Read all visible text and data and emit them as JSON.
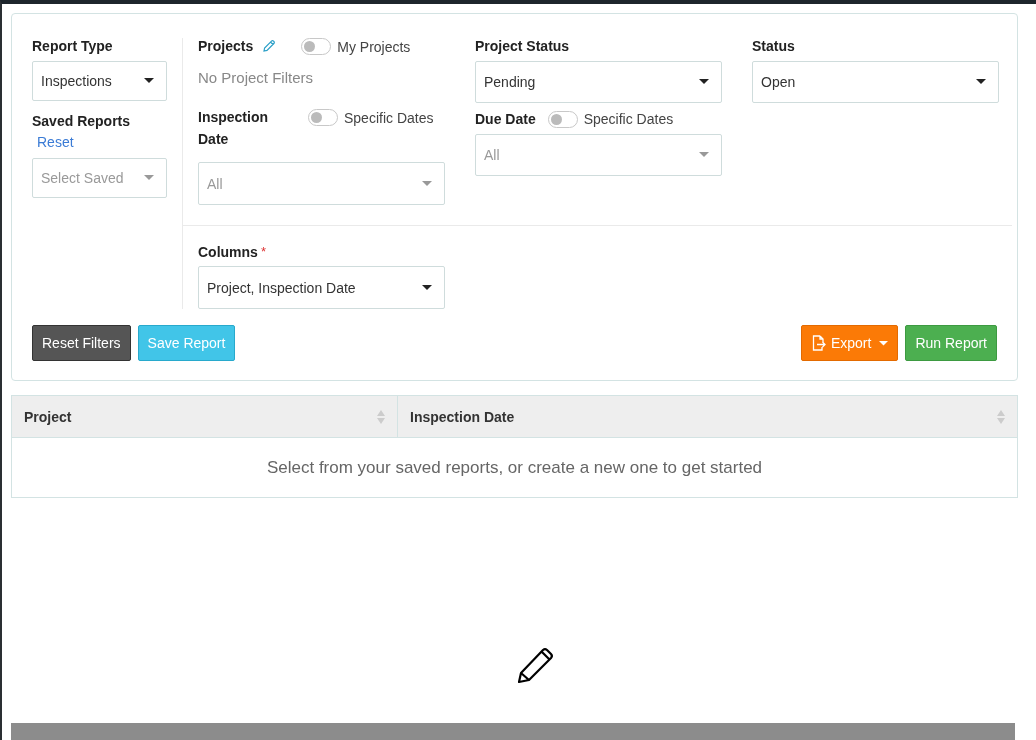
{
  "report_type": {
    "label": "Report Type",
    "select": {
      "value": "Inspections"
    }
  },
  "saved_reports": {
    "label": "Saved Reports",
    "reset_link": "Reset",
    "select": {
      "placeholder": "Select Saved"
    }
  },
  "projects": {
    "label": "Projects",
    "toggle": {
      "label": "My Projects",
      "on": false
    },
    "empty_text": "No Project Filters"
  },
  "project_status": {
    "label": "Project Status",
    "select": {
      "value": "Pending"
    }
  },
  "status": {
    "label": "Status",
    "select": {
      "value": "Open"
    }
  },
  "inspection_date": {
    "label": "Inspection Date",
    "toggle": {
      "label": "Specific Dates",
      "on": false
    },
    "select": {
      "placeholder": "All"
    }
  },
  "due_date": {
    "label": "Due Date",
    "toggle": {
      "label": "Specific Dates",
      "on": false
    },
    "select": {
      "placeholder": "All"
    }
  },
  "columns": {
    "label": "Columns",
    "required_mark": "*",
    "select": {
      "value": "Project, Inspection Date"
    }
  },
  "buttons": [
    {
      "label": "Reset Filters",
      "kind": "dark"
    },
    {
      "label": "Save Report",
      "kind": "info"
    },
    {
      "label": "Export",
      "kind": "export"
    },
    {
      "label": "Run Report",
      "kind": "success"
    }
  ],
  "table": {
    "columns": [
      "Project",
      "Inspection Date"
    ],
    "empty_message": "Select from your saved reports, or create a new one to get started"
  }
}
